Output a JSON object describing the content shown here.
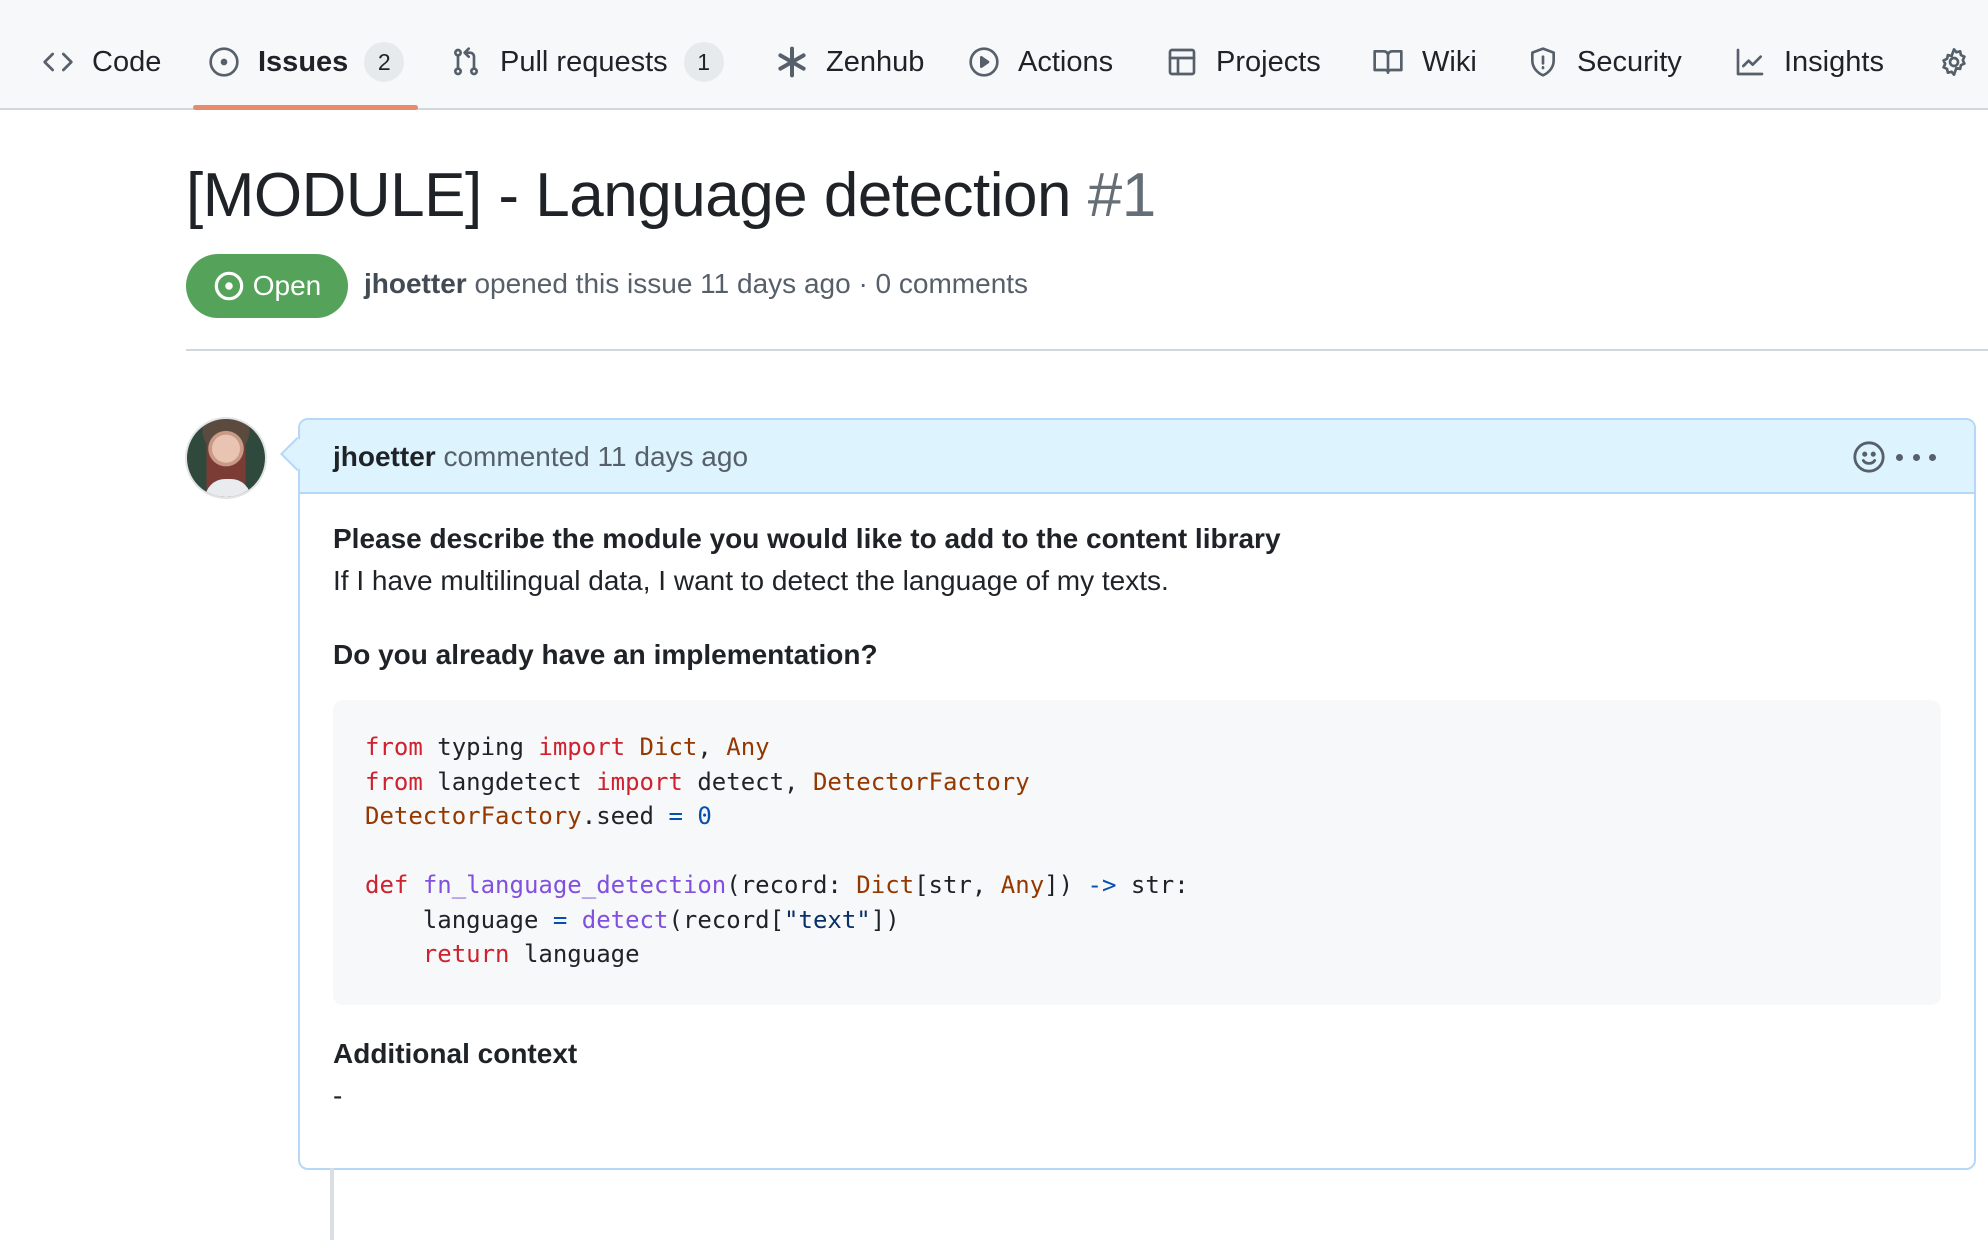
{
  "repo_nav": {
    "items": [
      {
        "label": "Code",
        "icon": "code-icon"
      },
      {
        "label": "Issues",
        "icon": "issue-opened-icon",
        "count": "2",
        "active": true
      },
      {
        "label": "Pull requests",
        "icon": "git-pull-request-icon",
        "count": "1"
      },
      {
        "label": "Zenhub",
        "icon": "zenhub-asterisk-icon"
      },
      {
        "label": "Actions",
        "icon": "play-icon"
      },
      {
        "label": "Projects",
        "icon": "table-icon"
      },
      {
        "label": "Wiki",
        "icon": "book-icon"
      },
      {
        "label": "Security",
        "icon": "shield-icon"
      },
      {
        "label": "Insights",
        "icon": "graph-icon"
      },
      {
        "label": "",
        "icon": "gear-icon"
      }
    ],
    "active_underline_color": "#e88a6c"
  },
  "issue": {
    "title": "[MODULE] - Language detection",
    "number": "#1",
    "state": "Open",
    "state_color": "#55a35a",
    "author": "jhoetter",
    "meta_text": " opened this issue 11 days ago · 0 comments"
  },
  "comment": {
    "author": "jhoetter",
    "meta_text": " commented 11 days ago",
    "header_bg": "#ddf4ff",
    "body": {
      "heading1": "Please describe the module you would like to add to the content library",
      "para1": "If I have multilingual data, I want to detect the language of my texts.",
      "heading2": "Do you already have an implementation?",
      "code_lines": [
        [
          {
            "t": "from",
            "c": "kw"
          },
          {
            "t": " typing "
          },
          {
            "t": "import",
            "c": "kw"
          },
          {
            "t": " "
          },
          {
            "t": "Dict",
            "c": "cls"
          },
          {
            "t": ", "
          },
          {
            "t": "Any",
            "c": "cls"
          }
        ],
        [
          {
            "t": "from",
            "c": "kw"
          },
          {
            "t": " langdetect "
          },
          {
            "t": "import",
            "c": "kw"
          },
          {
            "t": " detect, "
          },
          {
            "t": "DetectorFactory",
            "c": "cls"
          }
        ],
        [
          {
            "t": "DetectorFactory",
            "c": "cls"
          },
          {
            "t": ".seed "
          },
          {
            "t": "=",
            "c": "op"
          },
          {
            "t": " "
          },
          {
            "t": "0",
            "c": "num"
          }
        ],
        [],
        [
          {
            "t": "def",
            "c": "kw"
          },
          {
            "t": " "
          },
          {
            "t": "fn_language_detection",
            "c": "fn"
          },
          {
            "t": "(record: "
          },
          {
            "t": "Dict",
            "c": "cls"
          },
          {
            "t": "[str, "
          },
          {
            "t": "Any",
            "c": "cls"
          },
          {
            "t": "]) "
          },
          {
            "t": "->",
            "c": "op"
          },
          {
            "t": " str:"
          }
        ],
        [
          {
            "t": "    language "
          },
          {
            "t": "=",
            "c": "op"
          },
          {
            "t": " "
          },
          {
            "t": "detect",
            "c": "fn"
          },
          {
            "t": "(record["
          },
          {
            "t": "\"text\"",
            "c": "str"
          },
          {
            "t": "])"
          }
        ],
        [
          {
            "t": "    "
          },
          {
            "t": "return",
            "c": "kw"
          },
          {
            "t": " language"
          }
        ]
      ],
      "heading3": "Additional context",
      "para3": "-"
    }
  }
}
